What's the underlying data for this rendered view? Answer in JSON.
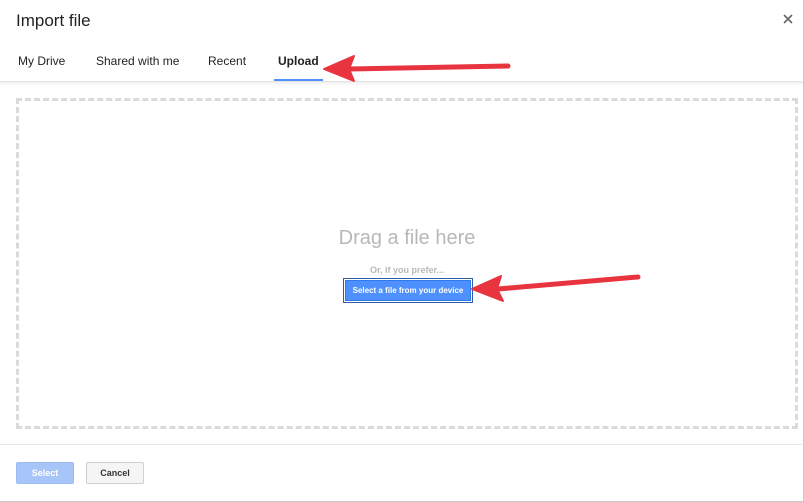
{
  "dialog": {
    "title": "Import file"
  },
  "tabs": [
    {
      "label": "My Drive",
      "active": false
    },
    {
      "label": "Shared with me",
      "active": false
    },
    {
      "label": "Recent",
      "active": false
    },
    {
      "label": "Upload",
      "active": true
    }
  ],
  "upload": {
    "drag_text": "Drag a file here",
    "prefer_text": "Or, if you prefer...",
    "select_device_label": "Select a file from your device"
  },
  "footer": {
    "select_label": "Select",
    "cancel_label": "Cancel"
  },
  "colors": {
    "accent": "#4d90fe",
    "annotation_arrow": "#e8343f"
  },
  "icons": [
    "close-icon"
  ]
}
